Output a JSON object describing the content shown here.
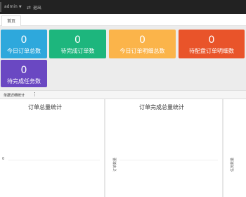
{
  "topbar": {
    "user": "admin",
    "logout": "退出"
  },
  "tabs": [
    {
      "label": "首页"
    }
  ],
  "stats": [
    {
      "value": "0",
      "label": "今日订单总数",
      "color": "#2ea8dc"
    },
    {
      "value": "0",
      "label": "待完成订单数",
      "color": "#1db67d"
    },
    {
      "value": "0",
      "label": "今日订单明细总数",
      "color": "#fbb44a"
    },
    {
      "value": "0",
      "label": "待配盘订单明细数",
      "color": "#e9542a"
    },
    {
      "value": "0",
      "label": "待完成任务数",
      "color": "#6a48c2"
    }
  ],
  "section": {
    "title": "单据详细统计",
    "menu_icon": "kebab-icon"
  },
  "charts": [
    {
      "title": "订单总量统计",
      "y_tick": "0",
      "y_label": ""
    },
    {
      "title": "订单完成总量统计",
      "y_tick": "",
      "y_label": "订单数量"
    },
    {
      "title": "",
      "y_tick": "",
      "y_label": "任务数量"
    }
  ],
  "colors": {
    "topbar": "#222222",
    "blue": "#2ea8dc",
    "green": "#1db67d",
    "orange": "#fbb44a",
    "red": "#e9542a",
    "purple": "#6a48c2"
  }
}
